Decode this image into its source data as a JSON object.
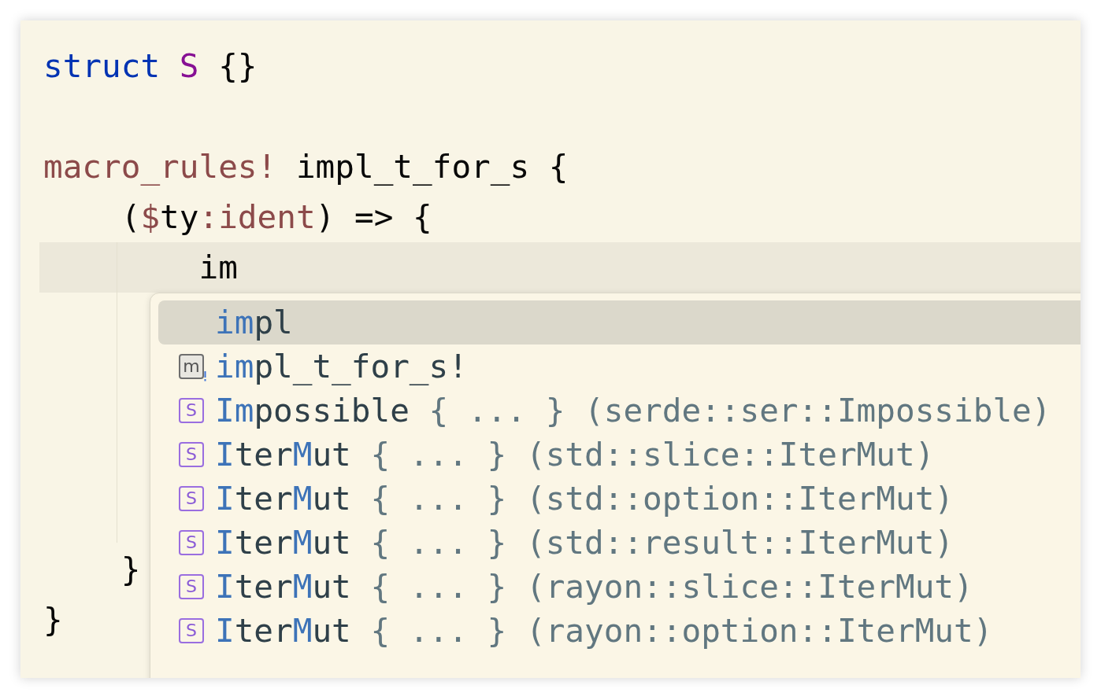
{
  "editor": {
    "lines": [
      {
        "current": false,
        "tokens": [
          {
            "kind": "keyword",
            "text": "struct "
          },
          {
            "kind": "type",
            "text": "S"
          },
          {
            "kind": "plain",
            "text": " {}"
          }
        ]
      },
      {
        "current": false
      },
      {
        "current": false,
        "tokens": [
          {
            "kind": "macro",
            "text": "macro_rules!"
          },
          {
            "kind": "plain",
            "text": " impl_t_for_s {"
          }
        ]
      },
      {
        "current": false,
        "tokens": [
          {
            "kind": "plain",
            "text": "    ("
          },
          {
            "kind": "macro",
            "text": "$"
          },
          {
            "kind": "plain",
            "text": "ty"
          },
          {
            "kind": "macro",
            "text": ":ident"
          },
          {
            "kind": "plain",
            "text": ") => {"
          }
        ]
      },
      {
        "current": true,
        "tokens": [
          {
            "kind": "plain",
            "text": "        im"
          }
        ]
      },
      {
        "current": false
      },
      {
        "current": false
      },
      {
        "current": false
      },
      {
        "current": false
      },
      {
        "current": false
      },
      {
        "current": false,
        "tokens": [
          {
            "kind": "plain",
            "text": "    }"
          }
        ]
      },
      {
        "current": false,
        "tokens": [
          {
            "kind": "plain",
            "text": "}"
          }
        ]
      }
    ]
  },
  "completion": {
    "items": [
      {
        "kind": "keyword",
        "selected": true,
        "name_parts": [
          {
            "text": "im",
            "match": true
          },
          {
            "text": "pl",
            "match": false
          }
        ]
      },
      {
        "kind": "macro",
        "badge": "m",
        "selected": false,
        "name_parts": [
          {
            "text": "im",
            "match": true
          },
          {
            "text": "pl_t_for_s!",
            "match": false
          }
        ]
      },
      {
        "kind": "struct",
        "badge": "S",
        "selected": false,
        "name_parts": [
          {
            "text": "Im",
            "match": true
          },
          {
            "text": "possible",
            "match": false
          }
        ],
        "detail": " { ... } (serde::ser::Impossible)"
      },
      {
        "kind": "struct",
        "badge": "S",
        "selected": false,
        "name_parts": [
          {
            "text": "I",
            "match": true
          },
          {
            "text": "ter",
            "match": false
          },
          {
            "text": "M",
            "match": true
          },
          {
            "text": "ut",
            "match": false
          }
        ],
        "detail": " { ... } (std::slice::IterMut)"
      },
      {
        "kind": "struct",
        "badge": "S",
        "selected": false,
        "name_parts": [
          {
            "text": "I",
            "match": true
          },
          {
            "text": "ter",
            "match": false
          },
          {
            "text": "M",
            "match": true
          },
          {
            "text": "ut",
            "match": false
          }
        ],
        "detail": " { ... } (std::option::IterMut)"
      },
      {
        "kind": "struct",
        "badge": "S",
        "selected": false,
        "name_parts": [
          {
            "text": "I",
            "match": true
          },
          {
            "text": "ter",
            "match": false
          },
          {
            "text": "M",
            "match": true
          },
          {
            "text": "ut",
            "match": false
          }
        ],
        "detail": " { ... } (std::result::IterMut)"
      },
      {
        "kind": "struct",
        "badge": "S",
        "selected": false,
        "name_parts": [
          {
            "text": "I",
            "match": true
          },
          {
            "text": "ter",
            "match": false
          },
          {
            "text": "M",
            "match": true
          },
          {
            "text": "ut",
            "match": false
          }
        ],
        "detail": " { ... } (rayon::slice::IterMut)"
      },
      {
        "kind": "struct",
        "badge": "S",
        "selected": false,
        "name_parts": [
          {
            "text": "I",
            "match": true
          },
          {
            "text": "ter",
            "match": false
          },
          {
            "text": "M",
            "match": true
          },
          {
            "text": "ut",
            "match": false
          }
        ],
        "detail": " { ... } (rayon::option::IterMut)"
      }
    ]
  }
}
